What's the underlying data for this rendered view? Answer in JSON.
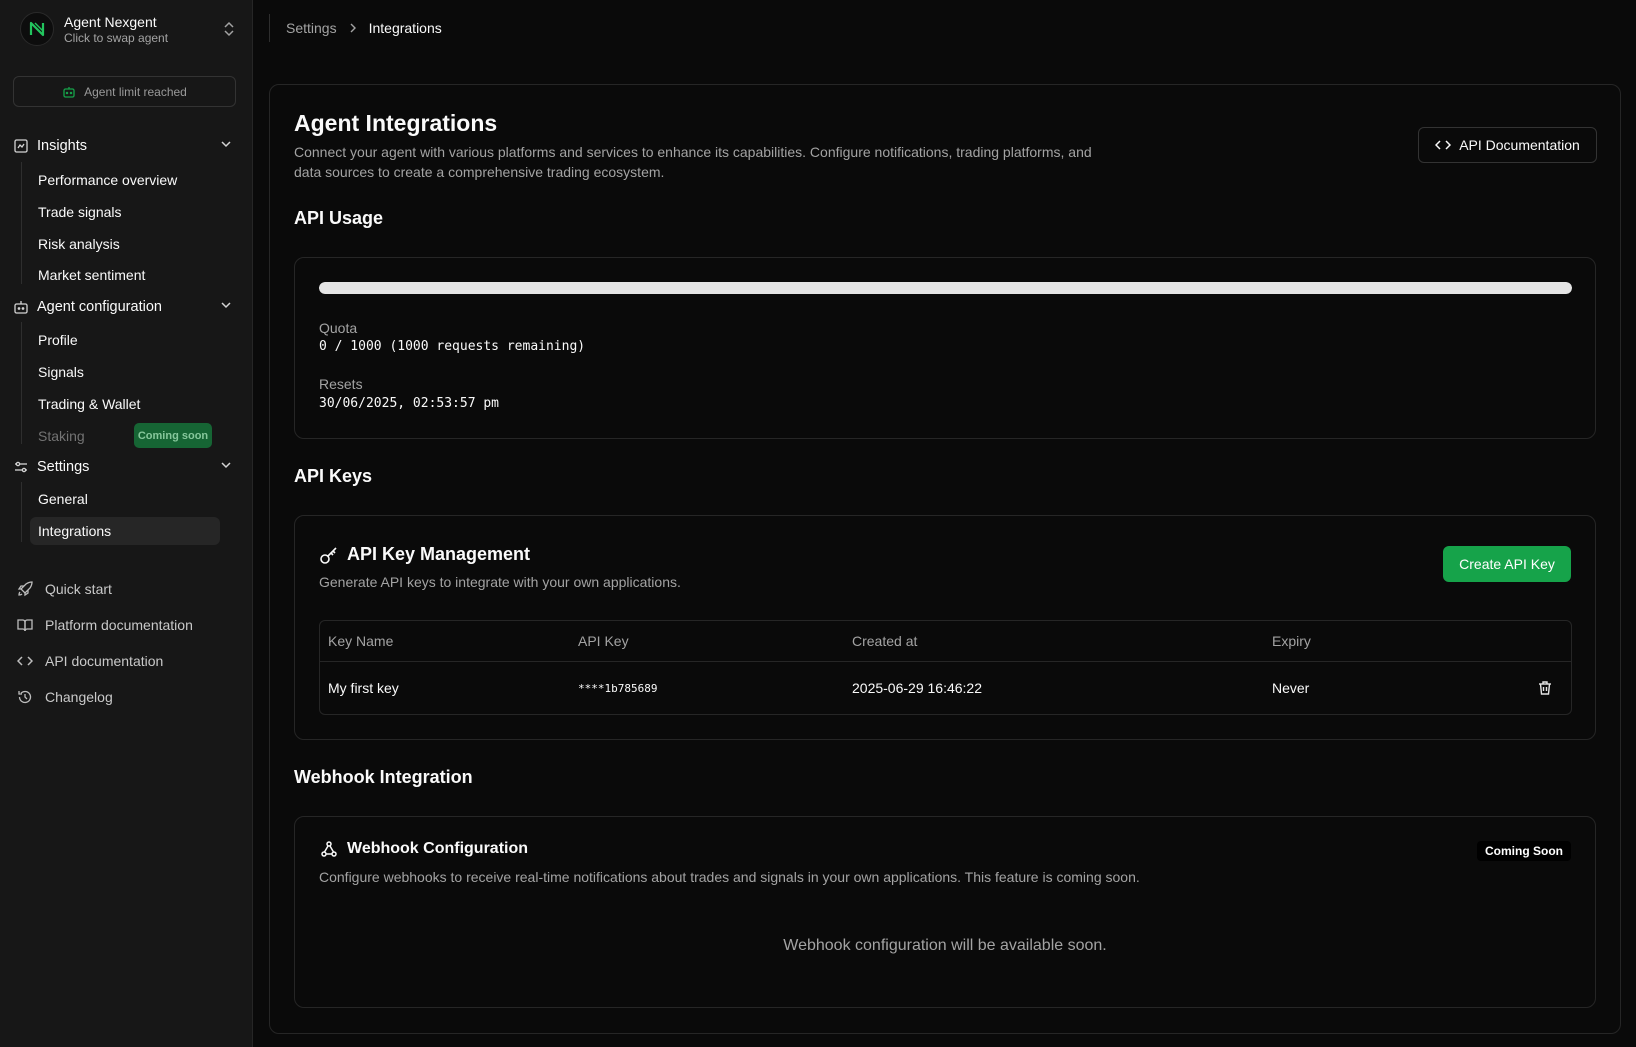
{
  "agent": {
    "name": "Agent Nexgent",
    "subtitle": "Click to swap agent",
    "limit_text": "Agent limit reached"
  },
  "sidebar": {
    "groups": [
      {
        "label": "Insights",
        "icon": "chart-square-icon",
        "items": [
          "Performance overview",
          "Trade signals",
          "Risk analysis",
          "Market sentiment"
        ]
      },
      {
        "label": "Agent configuration",
        "icon": "bot-icon",
        "items": [
          "Profile",
          "Signals",
          "Trading & Wallet",
          "Staking"
        ]
      },
      {
        "label": "Settings",
        "icon": "sliders-icon",
        "items": [
          "General",
          "Integrations"
        ]
      }
    ],
    "staking_badge": "Coming soon",
    "active_item": "Integrations",
    "footer_links": [
      {
        "label": "Quick start",
        "icon": "rocket-icon"
      },
      {
        "label": "Platform documentation",
        "icon": "book-icon"
      },
      {
        "label": "API documentation",
        "icon": "code-icon"
      },
      {
        "label": "Changelog",
        "icon": "history-icon"
      }
    ]
  },
  "breadcrumb": {
    "parent": "Settings",
    "separator": ">",
    "current": "Integrations"
  },
  "page": {
    "title": "Agent Integrations",
    "description": "Connect your agent with various platforms and services to enhance its capabilities. Configure notifications, trading platforms, and data sources to create a comprehensive trading ecosystem.",
    "api_doc_button": "API Documentation"
  },
  "api_usage": {
    "section_title": "API Usage",
    "progress_fraction": 1.0,
    "quota_label": "Quota",
    "quota_value": "0 / 1000 (1000 requests remaining)",
    "resets_label": "Resets",
    "resets_value": "30/06/2025, 02:53:57 pm"
  },
  "api_keys": {
    "section_title": "API Keys",
    "card_title": "API Key Management",
    "card_desc": "Generate API keys to integrate with your own applications.",
    "create_button": "Create API Key",
    "columns": [
      "Key Name",
      "API Key",
      "Created at",
      "Expiry"
    ],
    "rows": [
      {
        "name": "My first key",
        "key": "****1b785689",
        "created": "2025-06-29 16:46:22",
        "expiry": "Never"
      }
    ]
  },
  "webhook": {
    "section_title": "Webhook Integration",
    "card_title": "Webhook Configuration",
    "badge": "Coming Soon",
    "card_desc": "Configure webhooks to receive real-time notifications about trades and signals in your own applications. This feature is coming soon.",
    "empty_text": "Webhook configuration will be available soon."
  },
  "colors": {
    "accent_green": "#16a34a",
    "badge_green": "#166534",
    "background": "#0a0a0a",
    "sidebar": "#171717"
  }
}
